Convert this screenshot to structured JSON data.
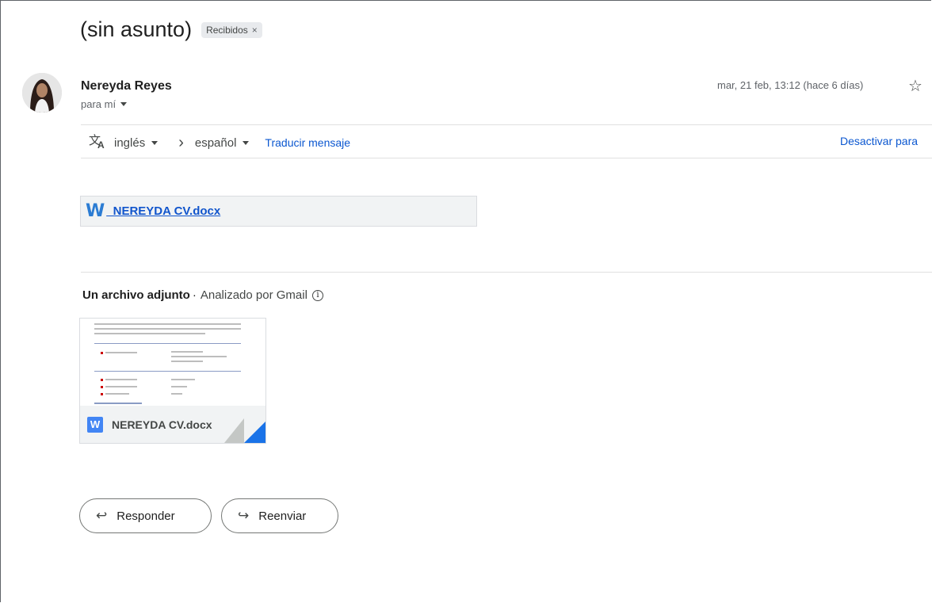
{
  "email": {
    "subject": "(sin asunto)",
    "label_chip": "Recibidos",
    "label_close": "×",
    "sender_name": "Nereyda Reyes",
    "recipient": "para mí",
    "date": "mar, 21 feb, 13:12 (hace 6 días)"
  },
  "translate_bar": {
    "source_language": "inglés",
    "arrow": "›",
    "target_language": "español",
    "translate_link": "Traducir mensaje",
    "disable_link": "Desactivar para"
  },
  "inline_attachment": {
    "icon_letter": "W",
    "file_name": "_NEREYDA CV.docx"
  },
  "attachments_section": {
    "heading_bold": "Un archivo adjunto",
    "heading_sep": "·",
    "heading_rest": "Analizado por Gmail",
    "card_icon_letter": "W",
    "card_file_name": "NEREYDA CV.docx"
  },
  "actions": {
    "reply_label": "Responder",
    "forward_label": "Reenviar"
  },
  "icons": {
    "star": "star-outline-icon",
    "translate": "translate-icon",
    "reply": "reply-icon",
    "forward": "forward-icon",
    "info": "info-icon"
  },
  "colors": {
    "link": "#0b57d0",
    "word_blue": "#4285f4",
    "chip_bg": "#e8eaed"
  }
}
